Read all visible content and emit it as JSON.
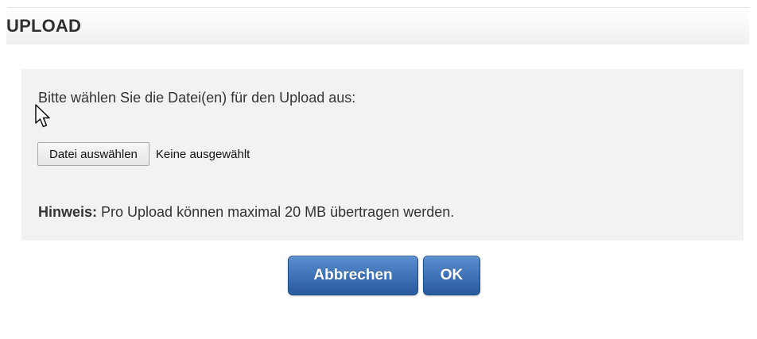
{
  "header": {
    "title": "UPLOAD"
  },
  "panel": {
    "instruction": "Bitte wählen Sie die Datei(en) für den Upload aus:",
    "file_input": {
      "button_label": "Datei auswählen",
      "status": "Keine ausgewählt"
    },
    "hint": {
      "label": "Hinweis:",
      "text": " Pro Upload können maximal 20 MB übertragen werden."
    }
  },
  "actions": {
    "cancel_label": "Abbrechen",
    "ok_label": "OK"
  },
  "colors": {
    "panel_background": "#f2f2f2",
    "primary_button": "#3f73b8",
    "text": "#333333"
  },
  "icons": {
    "cursor": "mouse-pointer-icon"
  }
}
